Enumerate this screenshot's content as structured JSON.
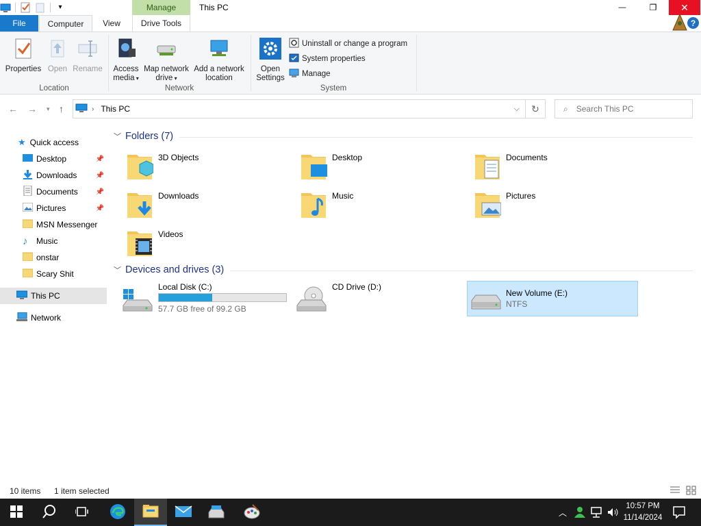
{
  "window": {
    "title": "This PC",
    "context_tab_group": "Manage",
    "minimize_glyph": "—",
    "restore_glyph": "❐",
    "close_glyph": "✕",
    "help_glyph": "?",
    "close_color": "#e81123"
  },
  "tabs": [
    {
      "label": "File",
      "active": false
    },
    {
      "label": "Computer",
      "active": true
    },
    {
      "label": "View",
      "active": false
    },
    {
      "label": "Drive Tools",
      "active": false
    }
  ],
  "ribbon": {
    "location": {
      "label": "Location",
      "properties": "Properties",
      "open": "Open",
      "rename": "Rename"
    },
    "network": {
      "label": "Network",
      "access_media": "Access media",
      "map_network_drive": "Map network drive",
      "add_network_location": "Add a network location"
    },
    "system": {
      "label": "System",
      "open_settings": "Open Settings",
      "uninstall": "Uninstall or change a program",
      "system_properties": "System properties",
      "manage": "Manage"
    }
  },
  "address": {
    "path": "This PC",
    "search_placeholder": "Search This PC"
  },
  "navpane": {
    "quick_access": "Quick access",
    "items": [
      {
        "label": "Desktop",
        "icon": "desktop-icon",
        "pinned": true
      },
      {
        "label": "Downloads",
        "icon": "downloads-icon",
        "pinned": true
      },
      {
        "label": "Documents",
        "icon": "documents-icon",
        "pinned": true
      },
      {
        "label": "Pictures",
        "icon": "pictures-icon",
        "pinned": true
      },
      {
        "label": "MSN Messenger",
        "icon": "folder-icon",
        "pinned": false
      },
      {
        "label": "Music",
        "icon": "music-icon",
        "pinned": false
      },
      {
        "label": "onstar",
        "icon": "folder-icon",
        "pinned": false
      },
      {
        "label": "Scary Shit",
        "icon": "folder-icon",
        "pinned": false
      }
    ],
    "this_pc": "This PC",
    "network": "Network",
    "pin_glyph": "📌"
  },
  "folders": {
    "header": "Folders (7)",
    "items": [
      {
        "label": "3D Objects",
        "icon": "3d-objects-icon"
      },
      {
        "label": "Desktop",
        "icon": "desktop-folder-icon"
      },
      {
        "label": "Documents",
        "icon": "documents-folder-icon"
      },
      {
        "label": "Downloads",
        "icon": "downloads-folder-icon"
      },
      {
        "label": "Music",
        "icon": "music-folder-icon"
      },
      {
        "label": "Pictures",
        "icon": "pictures-folder-icon"
      },
      {
        "label": "Videos",
        "icon": "videos-folder-icon"
      }
    ]
  },
  "drives": {
    "header": "Devices and drives (3)",
    "items": [
      {
        "label": "Local Disk (C:)",
        "sub": "57.7 GB free of 99.2 GB",
        "used_fraction": 0.418,
        "selected": false
      },
      {
        "label": "CD Drive (D:)",
        "sub": "",
        "selected": false
      },
      {
        "label": "New Volume (E:)",
        "sub": "NTFS",
        "selected": true
      }
    ]
  },
  "status": {
    "count": "10 items",
    "selection": "1 item selected"
  },
  "taskbar": {
    "time": "10:57 PM",
    "date": "11/14/2024",
    "accent": "#76b9ed"
  }
}
